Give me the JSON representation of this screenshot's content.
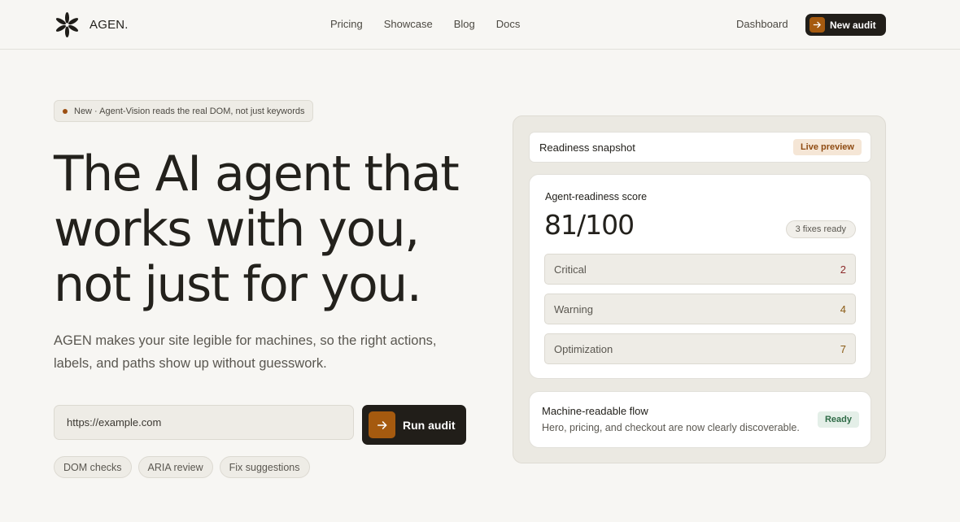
{
  "brand": {
    "name": "AGEN."
  },
  "nav": {
    "items": [
      {
        "label": "Pricing"
      },
      {
        "label": "Showcase"
      },
      {
        "label": "Blog"
      },
      {
        "label": "Docs"
      }
    ],
    "dashboard_label": "Dashboard",
    "new_audit_label": "New audit"
  },
  "hero": {
    "announcement": "New · Agent-Vision reads the real DOM, not just keywords",
    "title_lines": [
      "The AI agent that",
      "works with you,",
      "not just for you."
    ],
    "description": "AGEN makes your site legible for machines, so the right actions, labels, and paths show up without guesswork.",
    "url_input": {
      "value": "https://example.com",
      "placeholder": "https://example.com"
    },
    "run_button_label": "Run audit",
    "chips": [
      {
        "label": "DOM checks"
      },
      {
        "label": "ARIA review"
      },
      {
        "label": "Fix suggestions"
      }
    ]
  },
  "panel": {
    "snapshot_title": "Readiness snapshot",
    "live_badge": "Live preview",
    "score_label": "Agent-readiness score",
    "score_value": "81/100",
    "fixes_badge": "3 fixes ready",
    "issues": [
      {
        "label": "Critical",
        "count": "2",
        "color": "#8c2a2a"
      },
      {
        "label": "Warning",
        "count": "4",
        "color": "#8a5a14"
      },
      {
        "label": "Optimization",
        "count": "7",
        "color": "#8a5a14"
      }
    ],
    "flow_title": "Machine-readable flow",
    "flow_description": "Hero, pricing, and checkout are now clearly discoverable.",
    "ready_badge": "Ready"
  },
  "colors": {
    "accent": "#a55a0f",
    "dark": "#211e19",
    "background": "#f7f6f3"
  }
}
